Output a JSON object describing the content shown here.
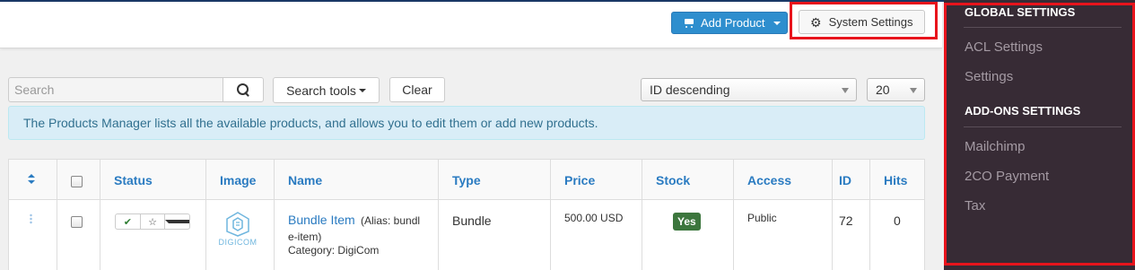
{
  "toolbar": {
    "add_product_label": "Add Product",
    "system_settings_label": "System Settings"
  },
  "filters": {
    "search_placeholder": "Search",
    "search_tools_label": "Search tools",
    "clear_label": "Clear",
    "ordering_value": "ID descending",
    "limit_value": "20"
  },
  "info_message": "The Products Manager lists all the available products, and allows you to edit them or add new products.",
  "table": {
    "columns": [
      "Status",
      "Image",
      "Name",
      "Type",
      "Price",
      "Stock",
      "Access",
      "ID",
      "Hits"
    ],
    "rows": [
      {
        "name": "Bundle Item",
        "alias_line1": "(Alias: bundl",
        "alias_line2": "e-item)",
        "category": "Category: DigiCom",
        "image_text": "DIGICOM",
        "type": "Bundle",
        "price": "500.00 USD",
        "stock": "Yes",
        "access": "Public",
        "id": "72",
        "hits": "0"
      }
    ]
  },
  "sidebar": {
    "global_heading": "GLOBAL SETTINGS",
    "global_items": [
      "ACL Settings",
      "Settings"
    ],
    "addons_heading": "ADD-ONS SETTINGS",
    "addons_items": [
      "Mailchimp",
      "2CO Payment",
      "Tax"
    ]
  },
  "colors": {
    "primary": "#2e8ece",
    "link": "#2a7bc1",
    "highlight": "#e8141c",
    "sidebar_bg": "#372b35",
    "info_bg": "#d9edf7",
    "success": "#3c763d"
  }
}
